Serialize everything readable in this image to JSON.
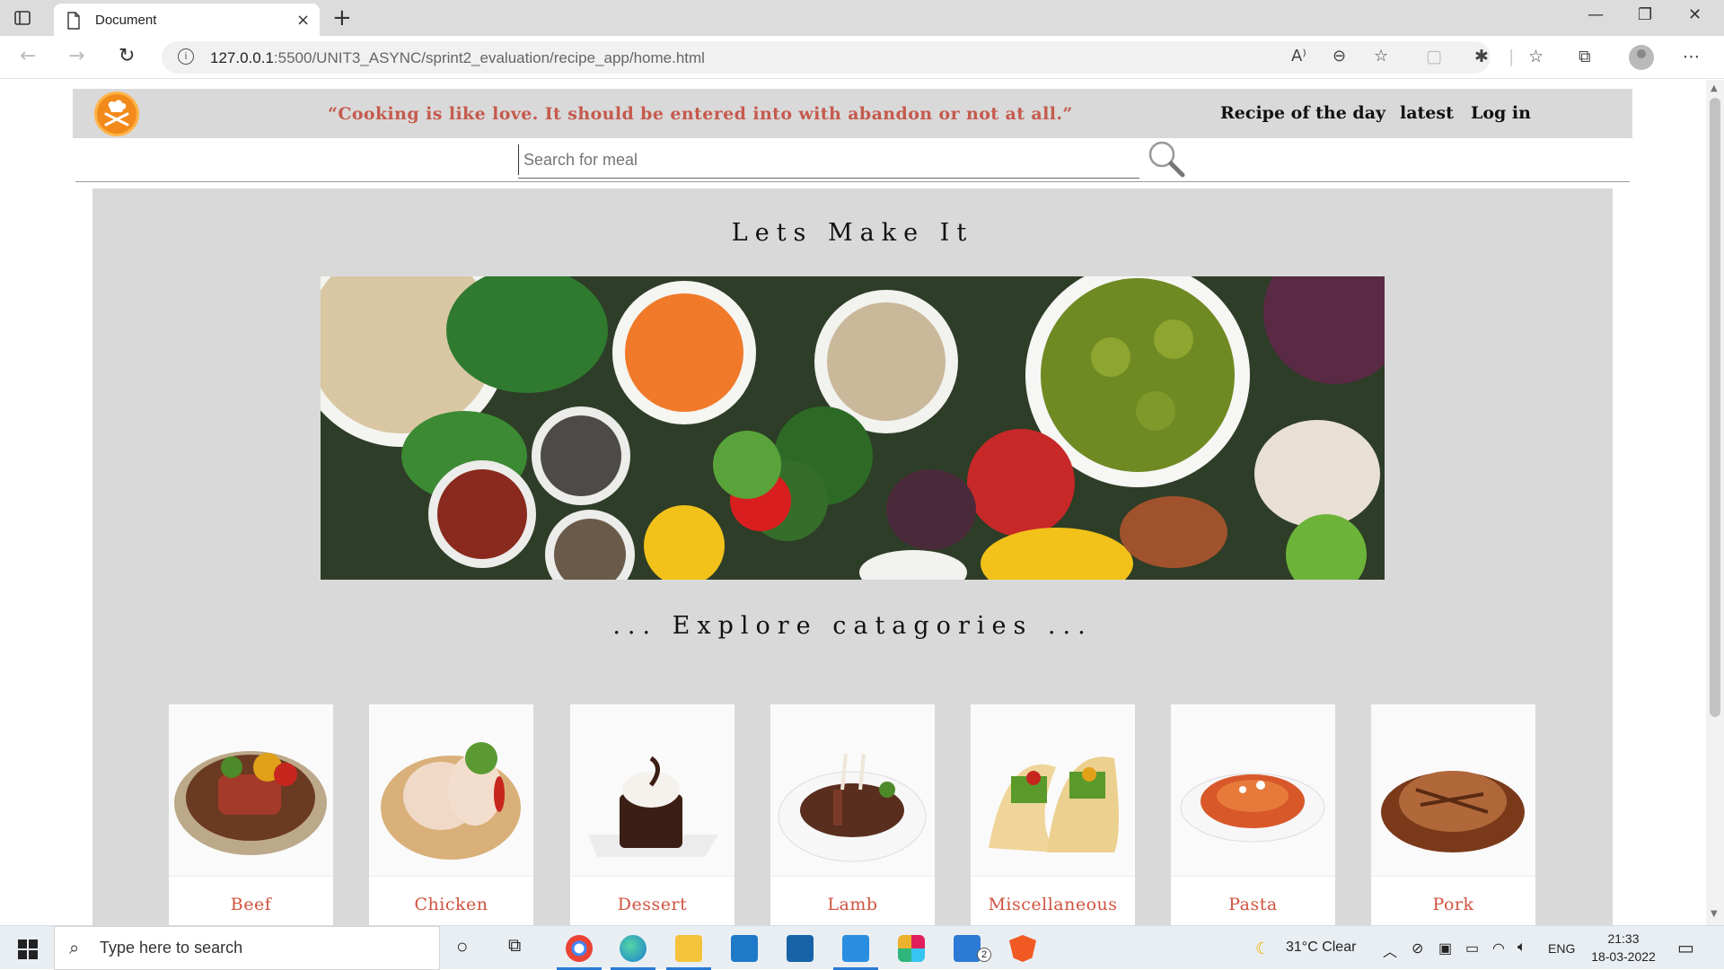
{
  "browser": {
    "tab_title": "Document",
    "url_host": "127.0.0.1",
    "url_path": ":5500/UNIT3_ASYNC/sprint2_evaluation/recipe_app/home.html",
    "new_tab_symbol": "+",
    "close_tab_symbol": "×"
  },
  "site": {
    "quote": "“Cooking is like love. It should be entered into with abandon or not at all.”",
    "nav": [
      "Recipe of the day",
      "latest",
      "Log in"
    ],
    "search_placeholder": "Search for meal",
    "heading": "Lets Make It",
    "explore_heading": "... Explore catagories ...",
    "categories": [
      {
        "name": "Beef",
        "icon": "beef-steak-plate"
      },
      {
        "name": "Chicken",
        "icon": "raw-chicken-plate"
      },
      {
        "name": "Dessert",
        "icon": "chocolate-cake"
      },
      {
        "name": "Lamb",
        "icon": "lamb-chops-plate"
      },
      {
        "name": "Miscellaneous",
        "icon": "tacos"
      },
      {
        "name": "Pasta",
        "icon": "penne-pasta-bowl"
      },
      {
        "name": "Pork",
        "icon": "pork-chop-board"
      }
    ],
    "accent_color": "#c55a4d",
    "category_label_color": "#d0533f",
    "panel_color": "#d9d9d9"
  },
  "taskbar": {
    "search_placeholder": "Type here to search",
    "weather": "31°C  Clear",
    "language": "ENG",
    "time": "21:33",
    "date": "18-03-2022",
    "todo_badge": "2"
  }
}
